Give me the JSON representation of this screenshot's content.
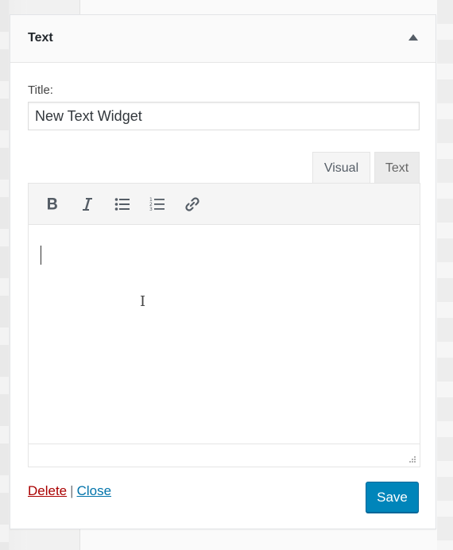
{
  "widget": {
    "title": "Text",
    "toggle_icon": "triangle-up-icon"
  },
  "form": {
    "title_label": "Title:",
    "title_value": "New Text Widget"
  },
  "editor": {
    "tabs": [
      {
        "label": "Visual",
        "active": true
      },
      {
        "label": "Text",
        "active": false
      }
    ],
    "toolbar": [
      {
        "name": "bold-icon"
      },
      {
        "name": "italic-icon"
      },
      {
        "name": "bulleted-list-icon"
      },
      {
        "name": "numbered-list-icon"
      },
      {
        "name": "link-icon"
      }
    ],
    "content": ""
  },
  "actions": {
    "delete_label": "Delete",
    "separator": "|",
    "close_label": "Close",
    "save_label": "Save"
  },
  "colors": {
    "primary": "#0085ba",
    "delete": "#aa0000",
    "link": "#0073aa"
  }
}
